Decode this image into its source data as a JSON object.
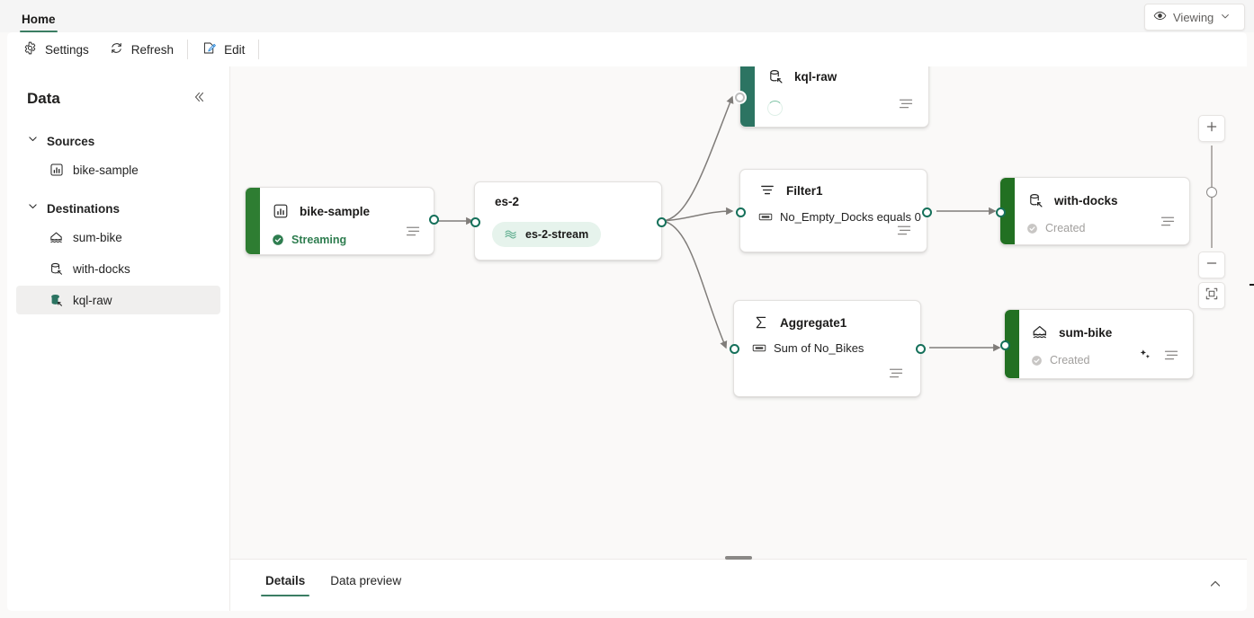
{
  "ribbon": {
    "tabs": [
      {
        "label": "Home",
        "active": true
      }
    ],
    "mode_pill": {
      "icon": "eye-icon",
      "label": "Viewing",
      "chevron": "chevron-down-icon"
    }
  },
  "commandbar": {
    "items": [
      {
        "label": "Settings",
        "icon": "gear-icon"
      },
      {
        "label": "Refresh",
        "icon": "refresh-icon"
      },
      {
        "label": "Edit",
        "icon": "edit-pencil-icon"
      }
    ]
  },
  "sidebar": {
    "title": "Data",
    "collapse_icon": "chevron-double-left-icon",
    "groups": [
      {
        "title": "Sources",
        "expanded": true,
        "items": [
          {
            "label": "bike-sample",
            "icon": "chart-box-icon",
            "selected": false
          }
        ]
      },
      {
        "title": "Destinations",
        "expanded": true,
        "items": [
          {
            "label": "sum-bike",
            "icon": "lakehouse-icon",
            "selected": false
          },
          {
            "label": "with-docks",
            "icon": "kql-database-icon",
            "selected": false
          },
          {
            "label": "kql-raw",
            "icon": "kql-database-filled-icon",
            "selected": true
          }
        ]
      }
    ]
  },
  "canvas": {
    "nodes": [
      {
        "id": "bike-sample",
        "title": "bike-sample",
        "icon": "chart-box-icon",
        "status": "Streaming",
        "status_kind": "streaming",
        "bar_color": "#2e7d32",
        "menu_icon": "hamburger-icon"
      },
      {
        "id": "es-2",
        "title": "es-2",
        "pill_label": "es-2-stream",
        "pill_icon": "eventstream-icon"
      },
      {
        "id": "kql-raw",
        "title": "kql-raw",
        "icon": "kql-database-icon",
        "status": "",
        "status_kind": "loading",
        "bar_color": "#2c7462",
        "menu_icon": "hamburger-icon"
      },
      {
        "id": "filter1",
        "title": "Filter1",
        "icon": "filter-icon",
        "expression": "No_Empty_Docks equals 0",
        "expression_icon": "field-icon",
        "menu_icon": "hamburger-icon"
      },
      {
        "id": "with-docks",
        "title": "with-docks",
        "icon": "kql-database-icon",
        "status": "Created",
        "status_kind": "created",
        "bar_color": "#227022",
        "menu_icon": "hamburger-icon"
      },
      {
        "id": "aggregate1",
        "title": "Aggregate1",
        "icon": "sigma-icon",
        "expression": "Sum of No_Bikes",
        "expression_icon": "field-icon",
        "menu_icon": "hamburger-icon"
      },
      {
        "id": "sum-bike",
        "title": "sum-bike",
        "icon": "lakehouse-icon",
        "status": "Created",
        "status_kind": "created",
        "bar_color": "#227022",
        "menu_icon": "hamburger-icon",
        "extra_icon": "sparkle-icon"
      }
    ],
    "zoom_controls": {
      "zoom_in": "plus-icon",
      "zoom_out": "minus-icon",
      "fit_to_screen": "fit-screen-icon"
    }
  },
  "bottom_panel": {
    "tabs": [
      {
        "label": "Details",
        "active": true
      },
      {
        "label": "Data preview",
        "active": false
      }
    ],
    "collapse_icon": "chevron-up-icon"
  },
  "colors": {
    "accent_green": "#3b7d63",
    "streaming_green": "#2e7d4f",
    "node_green": "#2e7d32",
    "kql_teal": "#2c7462",
    "pill_bg": "#e6f3ec",
    "canvas_bg": "#faf9f8"
  }
}
